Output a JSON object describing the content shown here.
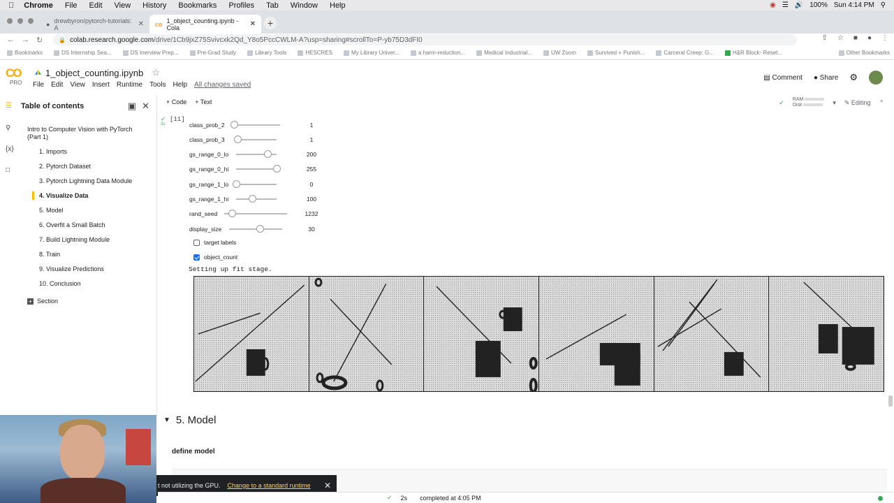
{
  "mac_menu": {
    "app": "Chrome",
    "items": [
      "File",
      "Edit",
      "View",
      "History",
      "Bookmarks",
      "Profiles",
      "Tab",
      "Window",
      "Help"
    ],
    "battery": "100%",
    "clock": "Sun 4:14 PM"
  },
  "tabs": [
    {
      "title": "drewbyron/pytorch-tutorials: A"
    },
    {
      "title": "1_object_counting.ipynb - Cola"
    }
  ],
  "address": {
    "host": "colab.research.google.com",
    "path": "/drive/1Cb9jxZ75Svivcxk2Qd_Y8o5PccCWLM-A?usp=sharing#scrollTo=P-yb75D3dFI0"
  },
  "bookmarks": [
    "Bookmarks",
    "DS Internship Sea...",
    "DS Inerview Prep...",
    "Pre-Grad Study",
    "Library Tools",
    "HESCRES",
    "My Library Univer...",
    "a harm-reduction...",
    "Medical Industrial...",
    "UW Zoom",
    "Survived + Punish...",
    "Carceral Creep: G...",
    "H&R Block- Reset...",
    "Other Bookmarks"
  ],
  "colab": {
    "logo": "CO",
    "pro": "PRO",
    "notebook_title": "1_object_counting.ipynb",
    "menus": [
      "File",
      "Edit",
      "View",
      "Insert",
      "Runtime",
      "Tools",
      "Help"
    ],
    "saved_status": "All changes saved",
    "comment": "Comment",
    "share": "Share"
  },
  "toolbar": {
    "code": "+ Code",
    "text": "+ Text",
    "ram": "RAM",
    "disk": "Disk",
    "editing": "Editing"
  },
  "toc": {
    "title": "Table of contents",
    "items": [
      {
        "label": "Intro to Computer Vision with PyTorch (Part 1)",
        "indent": 0
      },
      {
        "label": "1. Imports",
        "indent": 1
      },
      {
        "label": "2. Pytorch Dataset",
        "indent": 1
      },
      {
        "label": "3. Pytorch Lightning Data Module",
        "indent": 1
      },
      {
        "label": "4. Visualize Data",
        "indent": 1,
        "active": true
      },
      {
        "label": "5. Model",
        "indent": 1
      },
      {
        "label": "6. Overfit a Small Batch",
        "indent": 1
      },
      {
        "label": "7. Build Lightning Module",
        "indent": 1
      },
      {
        "label": "8.  Train",
        "indent": 1
      },
      {
        "label": "9.  Visualize Predictions",
        "indent": 1
      },
      {
        "label": "10.  Conclusion",
        "indent": 1
      }
    ],
    "section": "Section"
  },
  "cell": {
    "exec_count": "[11]",
    "run_time": "2s",
    "sliders": [
      {
        "label": "class_prob_2",
        "value": "1",
        "frac": 0.05
      },
      {
        "label": "class_prob_3",
        "value": "1",
        "frac": 0.05
      },
      {
        "label": "gs_range_0_lo",
        "value": "200",
        "frac": 0.78
      },
      {
        "label": "gs_range_0_hi",
        "value": "255",
        "frac": 1.0
      },
      {
        "label": "gs_range_1_lo",
        "value": "0",
        "frac": 0.0
      },
      {
        "label": "gs_range_1_hi",
        "value": "100",
        "frac": 0.39
      },
      {
        "label": "rand_seed",
        "value": "1232",
        "frac": 0.12
      },
      {
        "label": "display_size",
        "value": "30",
        "frac": 0.58
      }
    ],
    "checkboxes": [
      {
        "label": "target labels",
        "checked": false
      },
      {
        "label": "object_count",
        "checked": true
      }
    ],
    "output_text": "Setting up fit stage."
  },
  "section5": {
    "heading": "5. Model",
    "subheading": "define model"
  },
  "toast": {
    "message": "t not utilizing the GPU.",
    "link": "Change to a standard runtime"
  },
  "status": {
    "duration": "2s",
    "completed": "completed at 4:05 PM"
  },
  "colors": {
    "accent": "#1a73e8",
    "colab_orange": "#f9ab00",
    "success": "#34a853"
  }
}
